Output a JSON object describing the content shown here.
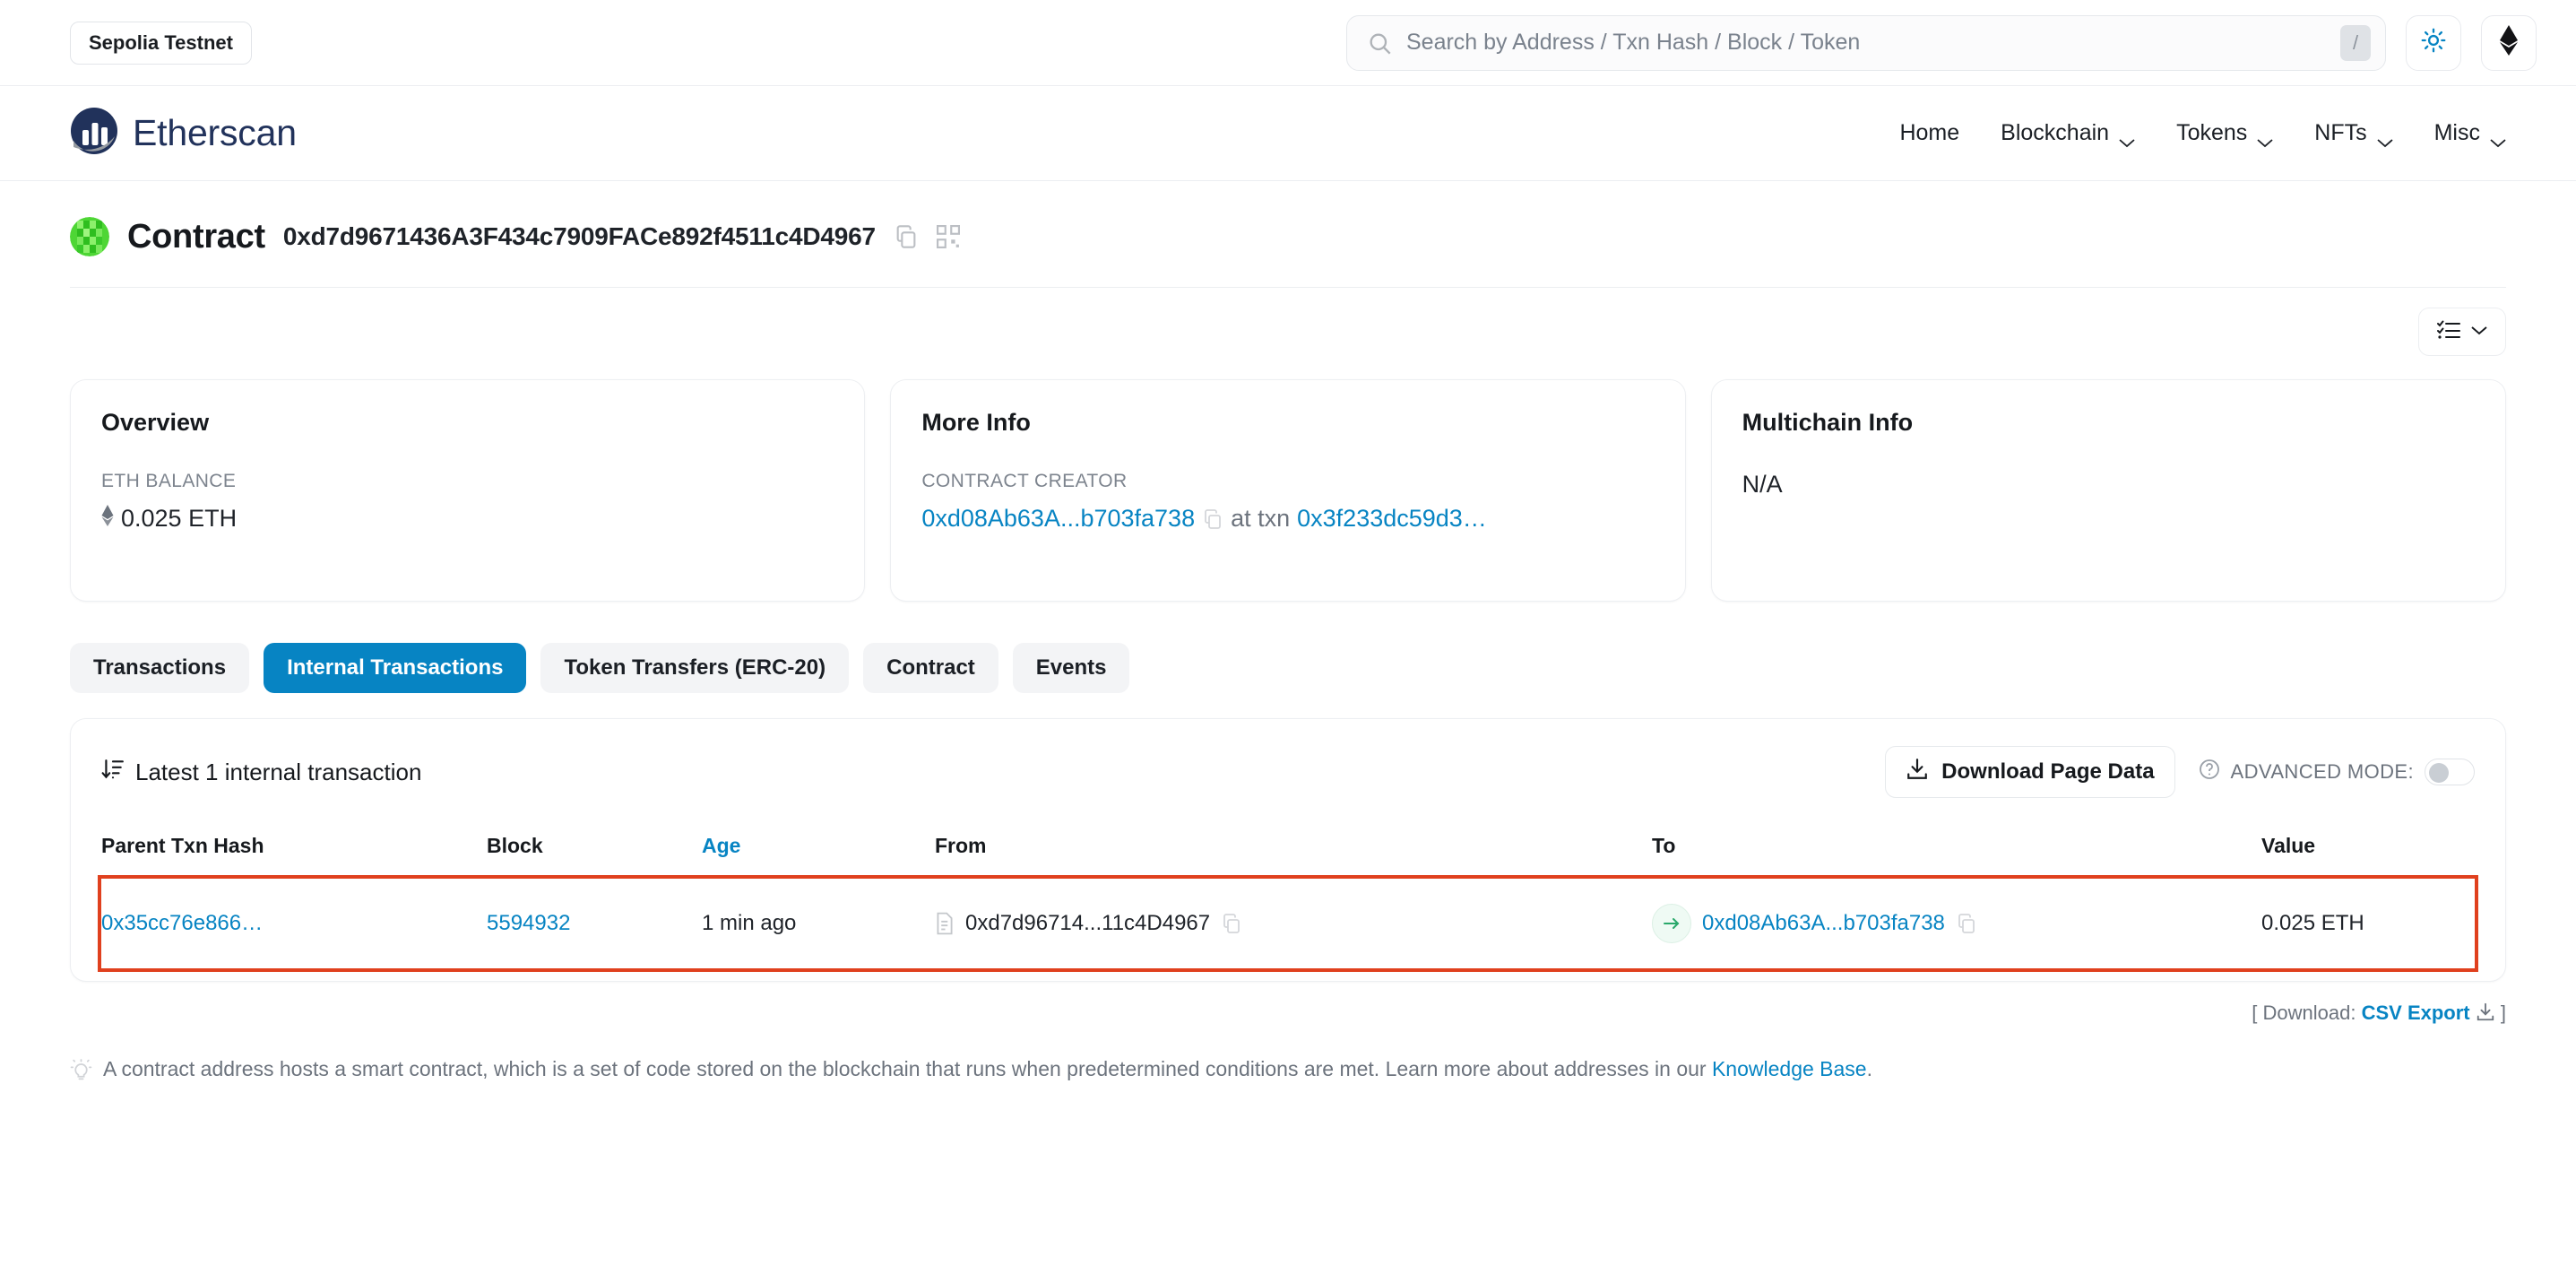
{
  "topbar": {
    "network_label": "Sepolia Testnet",
    "search_placeholder": "Search by Address / Txn Hash / Block / Token",
    "search_value": "",
    "search_shortcut": "/",
    "theme_icon": "sun-icon",
    "chain_icon": "ethereum-diamond-icon"
  },
  "nav": {
    "brand": "Etherscan",
    "links": [
      {
        "label": "Home",
        "has_chevron": false
      },
      {
        "label": "Blockchain",
        "has_chevron": true
      },
      {
        "label": "Tokens",
        "has_chevron": true
      },
      {
        "label": "NFTs",
        "has_chevron": true
      },
      {
        "label": "Misc",
        "has_chevron": true
      }
    ]
  },
  "page": {
    "title": "Contract",
    "address": "0xd7d9671436A3F434c7909FACe892f4511c4D4967",
    "copy_icon": "copy-icon",
    "qr_icon": "qr-code-icon",
    "options_icon": "checklist-icon"
  },
  "cards": {
    "overview": {
      "title": "Overview",
      "balance_label": "ETH BALANCE",
      "balance_value": "0.025 ETH"
    },
    "more_info": {
      "title": "More Info",
      "creator_label": "CONTRACT CREATOR",
      "creator_address": "0xd08Ab63A...b703fa738",
      "at_txn_label": "at txn",
      "creation_txn": "0x3f233dc59d3…"
    },
    "multichain": {
      "title": "Multichain Info",
      "value": "N/A"
    }
  },
  "tabs": [
    {
      "label": "Transactions",
      "active": false
    },
    {
      "label": "Internal Transactions",
      "active": true
    },
    {
      "label": "Token Transfers (ERC-20)",
      "active": false
    },
    {
      "label": "Contract",
      "active": false
    },
    {
      "label": "Events",
      "active": false
    }
  ],
  "panel": {
    "heading": "Latest 1 internal transaction",
    "sort_icon": "sort-descending-icon",
    "download_button": "Download Page Data",
    "download_icon": "download-icon",
    "advanced_mode_label": "ADVANCED MODE:",
    "advanced_mode_help_icon": "question-circle-icon",
    "advanced_mode_on": false,
    "columns": [
      "Parent Txn Hash",
      "Block",
      "Age",
      "From",
      "To",
      "Value"
    ],
    "rows": [
      {
        "parent_txn_hash": "0x35cc76e866…",
        "block": "5594932",
        "age": "1 min ago",
        "from": "0xd7d96714...11c4D4967",
        "from_icon": "contract-document-icon",
        "direction_icon": "arrow-right-icon",
        "to": "0xd08Ab63A...b703fa738",
        "value": "0.025 ETH",
        "highlighted": true
      }
    ]
  },
  "footer": {
    "csv_prefix": "[ Download: ",
    "csv_link": "CSV Export",
    "csv_icon": "download-icon",
    "csv_suffix": " ]",
    "note_icon": "lightbulb-icon",
    "note_text": "A contract address hosts a smart contract, which is a set of code stored on the blockchain that runs when predetermined conditions are met. Learn more about addresses in our ",
    "note_link": "Knowledge Base",
    "note_end": "."
  },
  "colors": {
    "accent_blue": "#0784c3",
    "brand_navy": "#21325b",
    "highlight_red": "#e0401e",
    "green": "#29a86a"
  }
}
